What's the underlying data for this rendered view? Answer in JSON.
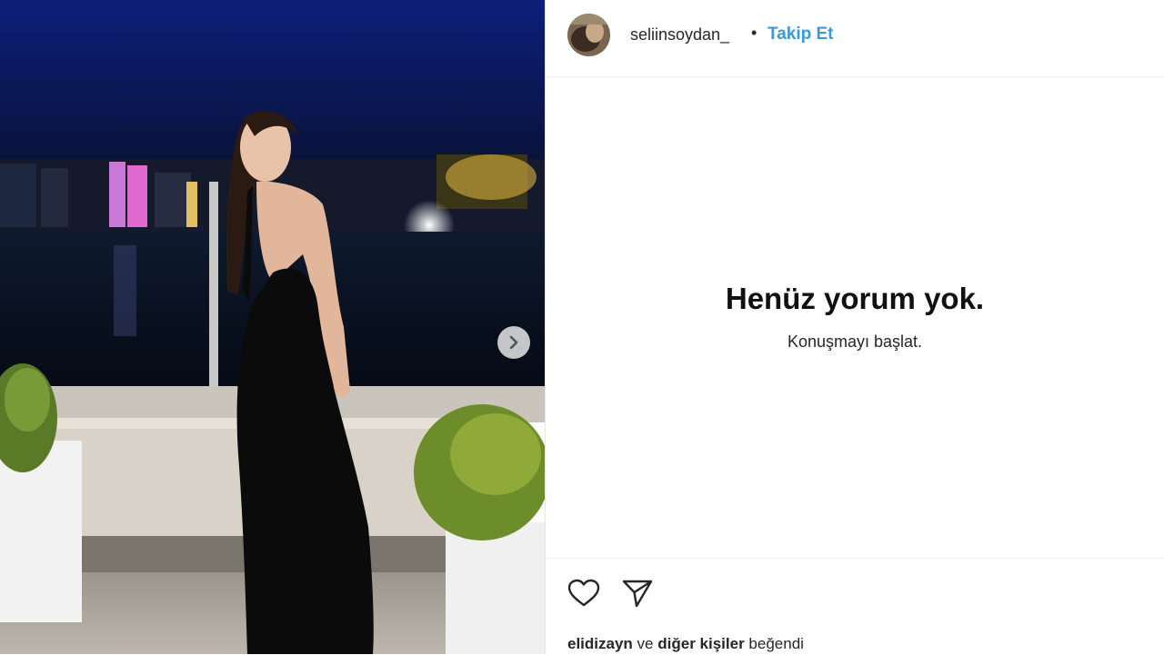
{
  "post": {
    "image_alt": "Woman in black backless dress by night waterfront",
    "carousel_next_icon": "chevron-right-icon"
  },
  "header": {
    "username": "seliinsoydan_",
    "separator": "•",
    "follow_label": "Takip Et"
  },
  "comments": {
    "empty_title": "Henüz yorum yok.",
    "empty_subtitle": "Konuşmayı başlat."
  },
  "actions": {
    "like_icon": "heart-icon",
    "share_icon": "send-icon"
  },
  "likes": {
    "first_user": "elidizayn",
    "connector": "ve",
    "others": "diğer kişiler",
    "suffix": "beğendi"
  },
  "colors": {
    "follow_accent": "#3a9ad9",
    "text": "#262626"
  }
}
